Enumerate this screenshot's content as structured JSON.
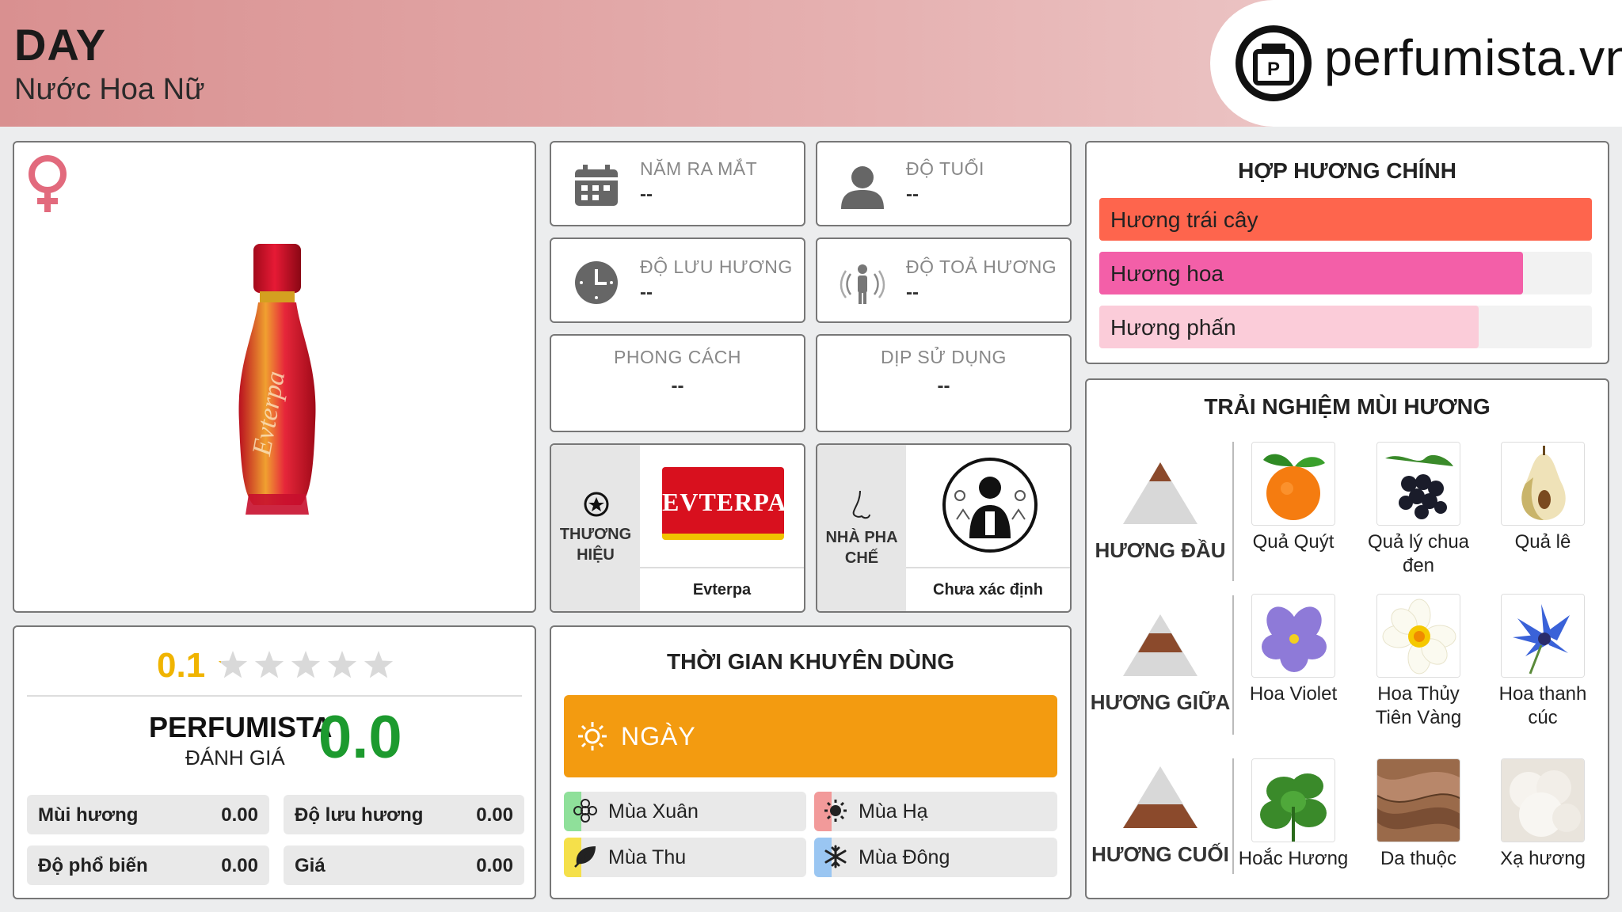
{
  "header": {
    "title": "DAY",
    "subtitle": "Nước Hoa Nữ",
    "brand": "perfumista.vn"
  },
  "product": {
    "gender_icon": "female-icon",
    "bottle_text": "Evterpa"
  },
  "info": {
    "release_year": {
      "label": "NĂM RA MẮT",
      "value": "--"
    },
    "age": {
      "label": "ĐỘ TUỔI",
      "value": "--"
    },
    "longevity": {
      "label": "ĐỘ LƯU HƯƠNG",
      "value": "--"
    },
    "sillage": {
      "label": "ĐỘ TOẢ HƯƠNG",
      "value": "--"
    },
    "style": {
      "label": "PHONG CÁCH",
      "value": "--"
    },
    "occasion": {
      "label": "DỊP SỬ DỤNG",
      "value": "--"
    },
    "brand": {
      "label_1": "THƯƠNG",
      "label_2": "HIỆU",
      "logo_text": "EVTERPA",
      "name": "Evterpa"
    },
    "perfumer": {
      "label_1": "NHÀ PHA",
      "label_2": "CHẾ",
      "name": "Chưa xác định"
    }
  },
  "rating": {
    "score": "0.1",
    "stars": 0.02,
    "perfumista_label": "PERFUMISTA",
    "perfumista_sub": "ĐÁNH GIÁ",
    "perfumista_score": "0.0",
    "stats": [
      {
        "name": "Mùi hương",
        "value": "0.00"
      },
      {
        "name": "Độ lưu hương",
        "value": "0.00"
      },
      {
        "name": "Độ phổ biến",
        "value": "0.00"
      },
      {
        "name": "Giá",
        "value": "0.00"
      }
    ]
  },
  "usage": {
    "title": "THỜI GIAN KHUYÊN DÙNG",
    "time": "NGÀY",
    "seasons": [
      {
        "name": "Mùa Xuân",
        "color": "#8fe09a"
      },
      {
        "name": "Mùa Hạ",
        "color": "#f29a9a"
      },
      {
        "name": "Mùa Thu",
        "color": "#f5e04a"
      },
      {
        "name": "Mùa Đông",
        "color": "#9ac6f2"
      }
    ]
  },
  "accords": {
    "title": "HỢP HƯƠNG CHÍNH",
    "items": [
      {
        "name": "Hương trái cây",
        "level": 1.0,
        "color": "#fe654d"
      },
      {
        "name": "Hương hoa",
        "level": 0.86,
        "color": "#f35fa8"
      },
      {
        "name": "Hương phấn",
        "level": 0.77,
        "color": "#fbccd9"
      }
    ]
  },
  "notes": {
    "title": "TRẢI NGHIỆM MÙI HƯƠNG",
    "top": {
      "label": "HƯƠNG ĐẦU",
      "items": [
        "Quả Quýt",
        "Quả lý chua đen",
        "Quả lê"
      ]
    },
    "middle": {
      "label": "HƯƠNG GIỮA",
      "items": [
        "Hoa Violet",
        "Hoa Thủy Tiên Vàng",
        "Hoa thanh cúc"
      ]
    },
    "base": {
      "label": "HƯƠNG CUỐI",
      "items": [
        "Hoắc Hương",
        "Da thuộc",
        "Xạ hương"
      ]
    }
  }
}
